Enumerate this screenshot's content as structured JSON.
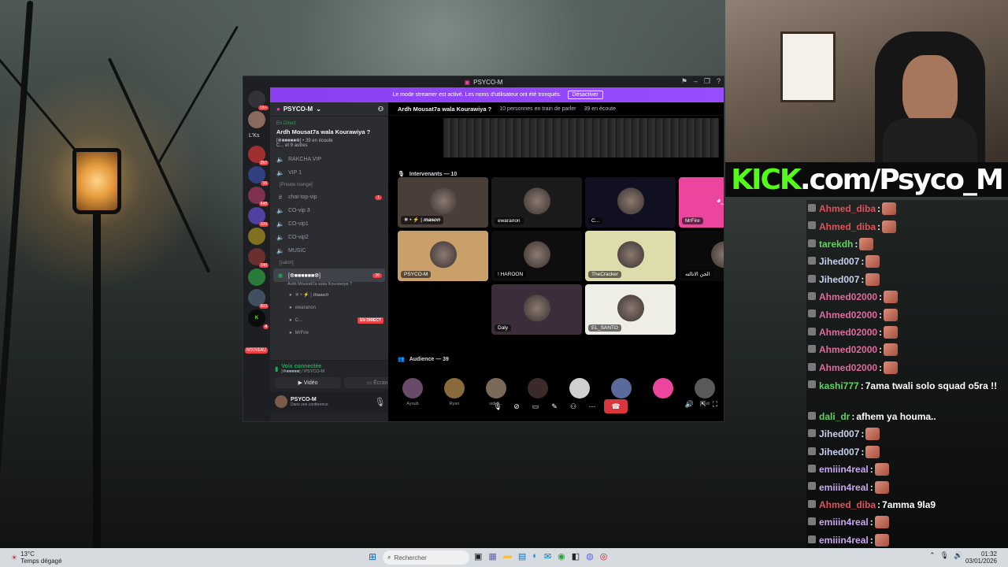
{
  "discord": {
    "window_title": "PSYCO-M",
    "streamer_banner": {
      "text": "Le mode streamer est activé. Les noms d'utilisateur ont été tronqués.",
      "button": "Désactiver"
    },
    "server_badges": [
      "1K+",
      "352",
      "16",
      "648",
      "109",
      "140",
      "603",
      "4",
      "NOUVEAU"
    ],
    "server_label": "L'Ks",
    "server_name": "PSYCO-M",
    "live_card": {
      "status": "En Direct",
      "title": "Ardh Mousat7a wala Kourawiya ?",
      "stage_line": "[❆■■■■■❆]  •  39 en écoute",
      "speakers_line": "C... et 9 autres"
    },
    "channels_top": [
      "RAKCHA VIP",
      "VIP 1"
    ],
    "category_private": "[Private lounge]",
    "channels_private": [
      {
        "name": "chat-top-vip",
        "badge": "1"
      },
      {
        "name": "CO-vip 3"
      },
      {
        "name": "CO-vip1"
      },
      {
        "name": "CO-vip2"
      },
      {
        "name": "MUSIC"
      }
    ],
    "category_salon": "[salon]",
    "active_stage": {
      "name": "[❆■■■■■■❆]",
      "subtitle": "Ardh Mousat7a wala Kourawiya ?",
      "badge": "26"
    },
    "stage_members": [
      "✵ • ⚡ | 𝒎𝒂𝒔𝒐𝒏",
      "ewaranon",
      "C...",
      "MrFire"
    ],
    "live_badge": "EN DIRECT",
    "voice_panel": {
      "status": "Voix connectée",
      "channel": "[❆■■■■■] / PSYCO-M",
      "video_label": "Vidéo",
      "screen_label": "Écran",
      "user_name": "PSYCO-M",
      "user_status": "Dans une conférence"
    },
    "channel_header": {
      "name": "Ardh Mousat7a wala Kourawiya ?",
      "speaking": "10 personnes en train de parler",
      "listening": "39 en écoute"
    },
    "speakers_section": "Intervenants — 10",
    "speakers": [
      {
        "name": "✵ • ⚡ | 𝒎𝒂𝒔𝒐𝒏",
        "color": "#4a3e38"
      },
      {
        "name": "ewaranon",
        "color": "#1a1a1a"
      },
      {
        "name": "C...",
        "color": "#101020"
      },
      {
        "name": "MrFire",
        "color": "#eb459e"
      },
      {
        "name": "PSYCO-M",
        "color": "#c9a06a"
      },
      {
        "name": "! HAROON",
        "color": "#0e0e0e"
      },
      {
        "name": "TheCracker",
        "color": "#dedcaa"
      },
      {
        "name": "الجن الاتالته",
        "color": "#0a0a0a"
      },
      {
        "name": "Daly",
        "color": "#3b2e3a"
      },
      {
        "name": "EL_SANTO",
        "color": "#efeee6"
      }
    ],
    "audience_section": "Audience — 39",
    "audience": [
      "Ayoub",
      "Ryan",
      "sidi 3...",
      "",
      "",
      "",
      "",
      "...hdi",
      "هشام الزواري",
      ""
    ]
  },
  "kick_banner": {
    "k": "KICK",
    "rest": ".com/Psyco_M"
  },
  "chat": [
    {
      "user": "Ahmed_diba",
      "color": "#e0525b",
      "text": "",
      "emote": true
    },
    {
      "user": "Ahmed_diba",
      "color": "#e0525b",
      "text": "",
      "emote": true
    },
    {
      "user": "tarekdh",
      "color": "#5fd35f",
      "text": "",
      "emote": true
    },
    {
      "user": "Jihed007",
      "color": "#c7d1f0",
      "text": "",
      "emote": true
    },
    {
      "user": "Jihed007",
      "color": "#c7d1f0",
      "text": "",
      "emote": true
    },
    {
      "user": "Ahmed02000",
      "color": "#e06aa0",
      "text": "",
      "emote": true
    },
    {
      "user": "Ahmed02000",
      "color": "#e06aa0",
      "text": "",
      "emote": true
    },
    {
      "user": "Ahmed02000",
      "color": "#e06aa0",
      "text": "",
      "emote": true
    },
    {
      "user": "Ahmed02000",
      "color": "#e06aa0",
      "text": "",
      "emote": true
    },
    {
      "user": "Ahmed02000",
      "color": "#e06aa0",
      "text": "",
      "emote": true
    },
    {
      "user": "kashi777",
      "color": "#5fd35f",
      "text": "7ama twali solo squad o5ra !!",
      "emote": false
    },
    {
      "user": "dali_dr",
      "color": "#5fd35f",
      "text": "afhem ya houma..",
      "emote": false
    },
    {
      "user": "Jihed007",
      "color": "#c7d1f0",
      "text": "",
      "emote": true
    },
    {
      "user": "Jihed007",
      "color": "#c7d1f0",
      "text": "",
      "emote": true
    },
    {
      "user": "emiiin4real",
      "color": "#c9a6f0",
      "text": "",
      "emote": true
    },
    {
      "user": "emiiin4real",
      "color": "#c9a6f0",
      "text": "",
      "emote": true
    },
    {
      "user": "Ahmed_diba",
      "color": "#e0525b",
      "text": "7amma 9la9",
      "emote": false
    },
    {
      "user": "emiiin4real",
      "color": "#c9a6f0",
      "text": "",
      "emote": true
    },
    {
      "user": "emiiin4real",
      "color": "#c9a6f0",
      "text": "",
      "emote": true
    },
    {
      "user": "emiiin4real",
      "color": "#c9a6f0",
      "text": "",
      "emote": true
    }
  ],
  "taskbar": {
    "weather_temp": "13°C",
    "weather_desc": "Temps dégagé",
    "search_placeholder": "Rechercher",
    "time": "01:32",
    "date": "03/01/2026"
  }
}
